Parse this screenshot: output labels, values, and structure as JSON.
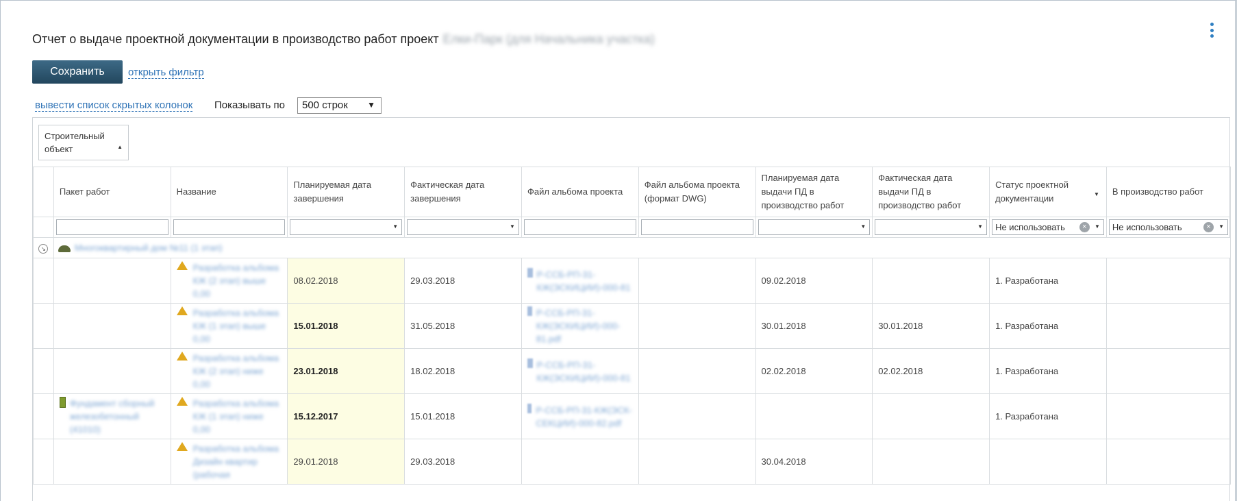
{
  "page": {
    "title": "Отчет о выдаче проектной документации в производство работ проект",
    "title_blurred": "Елки-Парк (для Начальника участка)",
    "save_label": "Сохранить",
    "open_filter_label": "открыть фильтр",
    "hidden_columns_label": "вывести список скрытых колонок",
    "show_by_label": "Показывать по",
    "rows_select_value": "500 строк"
  },
  "grouping": {
    "chip_label": "Строительный объект"
  },
  "columns": [
    "Пакет работ",
    "Название",
    "Планируемая дата завершения",
    "Фактическая дата завершения",
    "Файл альбома проекта",
    "Файл альбома проекта (формат DWG)",
    "Планируемая дата выдачи ПД в производство работ",
    "Фактическая дата выдачи ПД в производство работ",
    "Статус проектной документации",
    "В производство работ"
  ],
  "filters": {
    "status_value": "Не использовать",
    "production_value": "Не использовать"
  },
  "group_row": {
    "label": "Многоквартирный дом №11 (1 этап)"
  },
  "rows": [
    {
      "package": "",
      "name": "Разработка альбома КЖ (2 этап) выше 0,00",
      "plan_end": "08.02.2018",
      "plan_bold": false,
      "fact_end": "29.03.2018",
      "album_file": "Р-ССБ-РП-31-КЖ(ЭСКИЦИИ)-000-81",
      "dwg_file": "",
      "plan_issue": "09.02.2018",
      "fact_issue": "",
      "status": "1. Разработана",
      "production": ""
    },
    {
      "package": "",
      "name": "Разработка альбома КЖ (1 этап) выше 0,00",
      "plan_end": "15.01.2018",
      "plan_bold": true,
      "fact_end": "31.05.2018",
      "album_file": "Р-ССБ-РП-31-КЖ(ЭСКИЦИИ)-000-81.pdf",
      "dwg_file": "",
      "plan_issue": "30.01.2018",
      "fact_issue": "30.01.2018",
      "status": "1. Разработана",
      "production": ""
    },
    {
      "package": "",
      "name": "Разработка альбома КЖ (2 этап) ниже 0,00",
      "plan_end": "23.01.2018",
      "plan_bold": true,
      "fact_end": "18.02.2018",
      "album_file": "Р-ССБ-РП-31-КЖ(ЭСКИЦИИ)-000-81",
      "dwg_file": "",
      "plan_issue": "02.02.2018",
      "fact_issue": "02.02.2018",
      "status": "1. Разработана",
      "production": ""
    },
    {
      "package": "Фундамент сборный железобетонный (41010)",
      "name": "Разработка альбома КЖ (1 этап) ниже 0,00",
      "plan_end": "15.12.2017",
      "plan_bold": true,
      "fact_end": "15.01.2018",
      "album_file": "Р-ССБ-РП-31-КЖ(ЭСК-СЕКЦИИ)-000-82.pdf",
      "dwg_file": "",
      "plan_issue": "",
      "fact_issue": "",
      "status": "1. Разработана",
      "production": ""
    },
    {
      "package": "",
      "name": "Разработка альбома Дизайн квартир (рабочая",
      "plan_end": "29.01.2018",
      "plan_bold": false,
      "fact_end": "29.03.2018",
      "album_file": "",
      "dwg_file": "",
      "plan_issue": "30.04.2018",
      "fact_issue": "",
      "status": "",
      "production": ""
    }
  ]
}
